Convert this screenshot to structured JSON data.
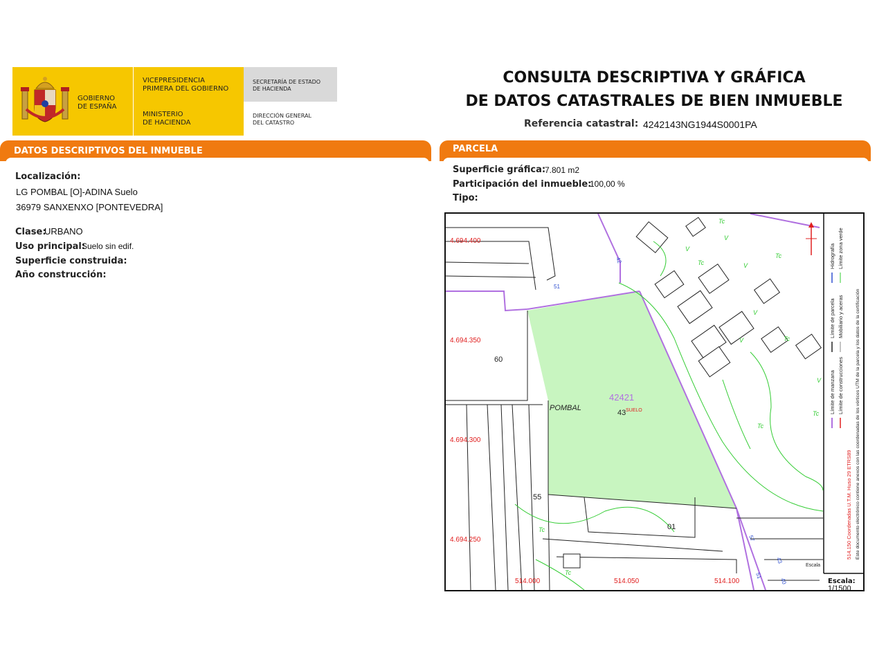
{
  "header": {
    "gobierno": "GOBIERNO\nDE ESPAÑA",
    "vicepresidencia": "VICEPRESIDENCIA\nPRIMERA DEL GOBIERNO",
    "ministerio": "MINISTERIO\nDE HACIENDA",
    "secretaria": "SECRETARÍA DE ESTADO\nDE HACIENDA",
    "direccion": "DIRECCIÓN GENERAL\nDEL CATASTRO",
    "title_line1": "CONSULTA DESCRIPTIVA Y GRÁFICA",
    "title_line2": "DE DATOS CATASTRALES DE BIEN INMUEBLE",
    "ref_label": "Referencia catastral:",
    "ref_value": "4242143NG1944S0001PA"
  },
  "descriptivos": {
    "heading": "DATOS DESCRIPTIVOS DEL INMUEBLE",
    "localizacion_label": "Localización:",
    "localizacion_line1": "LG POMBAL [O]-ADINA  Suelo",
    "localizacion_line2": "36979 SANXENXO [PONTEVEDRA]",
    "clase_label": "Clase:",
    "clase_value": "URBANO",
    "uso_label": "Uso principal:",
    "uso_value": "Suelo sin edif.",
    "superficie_label": "Superficie construida:",
    "anio_label": "Año construcción:"
  },
  "parcela": {
    "heading": "PARCELA",
    "superficie_label": "Superficie gráfica:",
    "superficie_value": "7.801 m2",
    "participacion_label": "Participación del inmueble:",
    "participacion_value": "100,00 %",
    "tipo_label": "Tipo:"
  },
  "map": {
    "y_coords": [
      "4.694.400",
      "4.694.350",
      "4.694.300",
      "4.694.250"
    ],
    "x_coords": [
      "514.000",
      "514.050",
      "514.100"
    ],
    "parcel_number": "42421",
    "parcel_sub": "43",
    "suelo_tag": "SUELO",
    "place_name": "POMBAL",
    "lot_60": "60",
    "lot_55": "55",
    "lot_01": "01",
    "escala_label": "Escala:",
    "escala_value": "1/1500",
    "escala_small": "Escala",
    "legend_1": "Límite de manzana",
    "legend_2": "Límite de parcela",
    "legend_3": "Hidrografía",
    "legend_4": "Límite de construcciones",
    "legend_5": "Mobiliario y aceras",
    "legend_6": "Límite zona verde",
    "legend_7": "514.150 Coordenadas U.T.M. Huso 29 ETRS89",
    "legend_8": "Este documento electrónico contiene anexos con las coordenadas de los vértices UTM de la parcela y los datos de la certificación",
    "veg_tc": "Tc",
    "veg_v": "V",
    "edge_labels": [
      "42",
      "51",
      "43",
      "40",
      "51",
      "57"
    ]
  },
  "colors": {
    "orange": "#f07a10",
    "yellow": "#f6c700",
    "parcel_fill": "#c8f5c0",
    "parcel_border": "#b070e0",
    "green_lines": "#33cc33"
  }
}
